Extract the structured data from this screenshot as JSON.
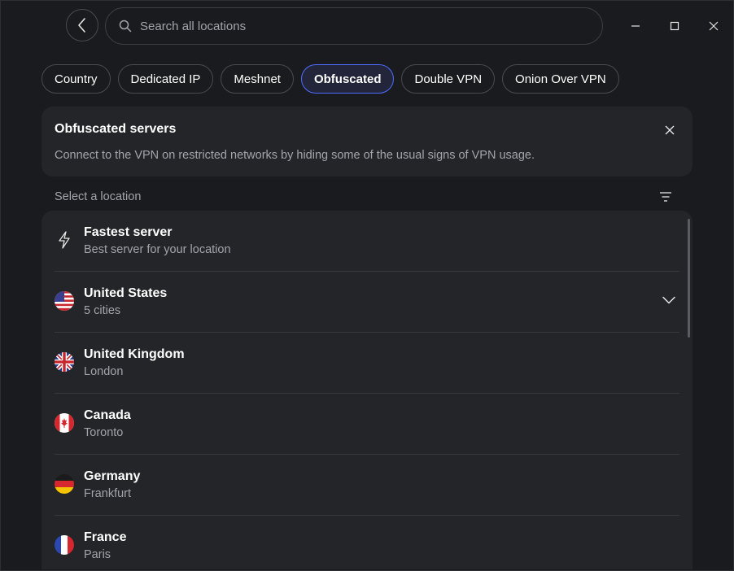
{
  "search": {
    "placeholder": "Search all locations"
  },
  "chips": [
    {
      "label": "Country"
    },
    {
      "label": "Dedicated IP"
    },
    {
      "label": "Meshnet"
    },
    {
      "label": "Obfuscated",
      "active": true
    },
    {
      "label": "Double VPN"
    },
    {
      "label": "Onion Over VPN"
    }
  ],
  "info": {
    "title": "Obfuscated servers",
    "description": "Connect to the VPN on restricted networks by hiding some of the usual signs of VPN usage."
  },
  "select_label": "Select a location",
  "locations": [
    {
      "name": "Fastest server",
      "sub": "Best server for your location",
      "icon": "lightning-icon"
    },
    {
      "name": "United States",
      "sub": "5 cities",
      "icon": "us-flag-icon",
      "expandable": true
    },
    {
      "name": "United Kingdom",
      "sub": "London",
      "icon": "uk-flag-icon"
    },
    {
      "name": "Canada",
      "sub": "Toronto",
      "icon": "canada-flag-icon"
    },
    {
      "name": "Germany",
      "sub": "Frankfurt",
      "icon": "germany-flag-icon"
    },
    {
      "name": "France",
      "sub": "Paris",
      "icon": "france-flag-icon"
    }
  ],
  "colors": {
    "background": "#1a1b1e",
    "card": "#242529",
    "accent": "#4d6bff",
    "muted_text": "#a3a4aa"
  }
}
